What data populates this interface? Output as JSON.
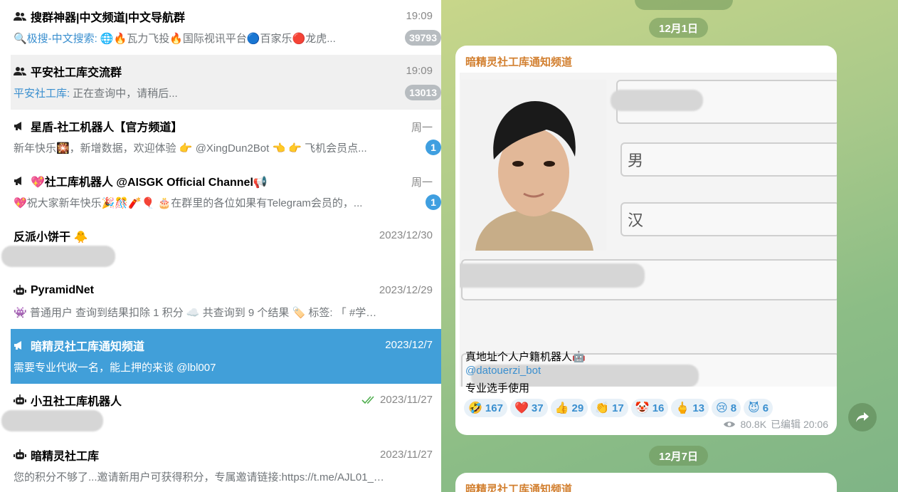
{
  "chats": [
    {
      "kind": "group",
      "title": "搜群神器|中文频道|中文导航群",
      "time": "19:09",
      "sender": "🔍极搜-中文搜索:",
      "preview": "🌐🔥瓦力飞投🔥国际视讯平台🔵百家乐🔴龙虎...",
      "badge": "39793",
      "badge_style": "muted"
    },
    {
      "kind": "group",
      "title": "平安社工库交流群",
      "time": "19:09",
      "sender": "平安社工库:",
      "preview": "正在查询中，请稍后...",
      "badge": "13013",
      "badge_style": "muted"
    },
    {
      "kind": "channel",
      "title": "星盾-社工机器人【官方频道】",
      "time": "周一",
      "sender": "",
      "preview": "新年快乐🎇，新增数据，欢迎体验 👉 @XingDun2Bot 👈 👉 飞机会员点...",
      "badge": "1",
      "badge_style": "blue"
    },
    {
      "kind": "channel",
      "title": "💖社工库机器人 @AISGK Official Channel📢",
      "time": "周一",
      "sender": "",
      "preview": "💖祝大家新年快乐🎉🎊🧨🎈 🎂在群里的各位如果有Telegram会员的，...",
      "badge": "1",
      "badge_style": "blue"
    },
    {
      "kind": "none",
      "title": "反派小饼干 🐥",
      "time": "2023/12/30",
      "sender": "",
      "preview": "",
      "badge": ""
    },
    {
      "kind": "bot",
      "title": "PyramidNet",
      "time": "2023/12/29",
      "sender": "",
      "preview": "👾 普通用户 查询到结果扣除 1 积分 ☁️ 共查询到 9 个结果 🏷️ 标签: 「 #学习通...",
      "badge": ""
    },
    {
      "kind": "channel",
      "title": "暗精灵社工库通知频道",
      "time": "2023/12/7",
      "sender": "",
      "preview": "需要专业代收一名，能上押的来谈 @lbl007",
      "badge": ""
    },
    {
      "kind": "bot",
      "title": "小丑社工库机器人",
      "time": "2023/11/27",
      "sender": "",
      "preview": "",
      "badge": ""
    },
    {
      "kind": "bot",
      "title": "暗精灵社工库",
      "time": "2023/11/27",
      "sender": "",
      "preview": "您的积分不够了...邀请新用户可获得积分，专属邀请链接:https://t.me/AJL01_bot?...",
      "badge": ""
    }
  ],
  "chat_area": {
    "date_chip_1": "12月1日",
    "date_chip_2": "12月7日",
    "post": {
      "channel_name": "暗精灵社工库通知频道",
      "id_gender": "男",
      "id_ethnicity": "汉",
      "caption_line1": "真地址个人户籍机器人🤖",
      "caption_link": "@datouerzi_bot",
      "caption_line3": "专业选手使用",
      "reactions": [
        {
          "emoji": "🤣",
          "count": "167"
        },
        {
          "emoji": "❤️",
          "count": "37"
        },
        {
          "emoji": "👍",
          "count": "29"
        },
        {
          "emoji": "👏",
          "count": "17"
        },
        {
          "emoji": "🤡",
          "count": "16"
        },
        {
          "emoji": "🖕",
          "count": "13"
        },
        {
          "emoji": "😢",
          "count": "8"
        },
        {
          "emoji": "😈",
          "count": "6"
        }
      ],
      "views": "80.8K",
      "edited": "已编辑 20:06"
    },
    "post2_channel_name": "暗精灵社工库通知频道"
  },
  "colors": {
    "accent": "#419fd9",
    "channel_name": "#d27f2f",
    "link": "#3a8fcf",
    "badge_blue": "#3f9fe0",
    "badge_muted": "#b7bcc0"
  }
}
